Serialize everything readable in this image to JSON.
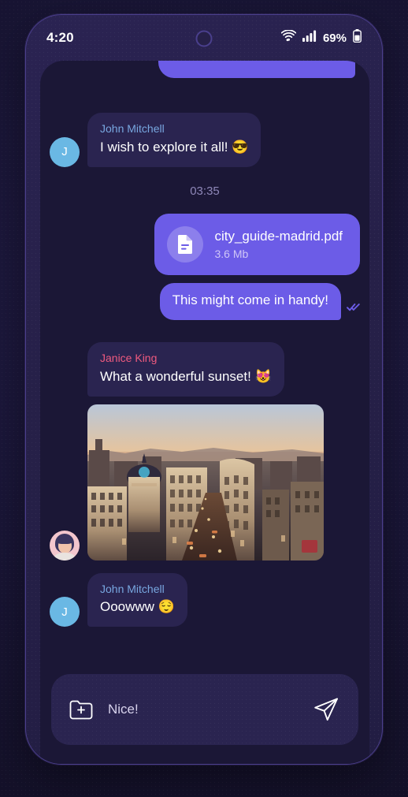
{
  "status_bar": {
    "time": "4:20",
    "battery_percent": "69%",
    "icons": [
      "wifi-icon",
      "cellular-signal-icon",
      "battery-icon",
      "camera-punch-hole"
    ]
  },
  "chat": {
    "timestamp_divider": "03:35",
    "messages": [
      {
        "id": "clipped",
        "direction": "outgoing",
        "text": ""
      },
      {
        "id": "m1",
        "direction": "incoming",
        "sender": "John Mitchell",
        "sender_color": "#78a7e0",
        "text": "I wish to explore it all! 😎",
        "avatar_letter": "J"
      },
      {
        "id": "m2",
        "direction": "outgoing",
        "type": "file",
        "file_name": "city_guide-madrid.pdf",
        "file_size": "3.6 Mb",
        "file_icon": "document-icon"
      },
      {
        "id": "m3",
        "direction": "outgoing",
        "text": "This might come in handy!",
        "receipt": "read-double-check"
      },
      {
        "id": "m4",
        "direction": "incoming",
        "sender": "Janice King",
        "sender_color": "#ef5a7f",
        "text": "What a wonderful sunset! 😻"
      },
      {
        "id": "m5",
        "direction": "incoming",
        "type": "photo",
        "photo_alt": "Madrid Gran Via cityscape at sunset",
        "avatar_type": "photo"
      },
      {
        "id": "m6",
        "direction": "incoming",
        "sender": "John Mitchell",
        "sender_color": "#78a7e0",
        "text": "Ooowww 😌",
        "avatar_letter": "J"
      }
    ]
  },
  "composer": {
    "value": "Nice!",
    "placeholder": "Message",
    "attach_icon": "folder-plus-icon",
    "send_icon": "send-paper-plane-icon"
  },
  "colors": {
    "accent_purple": "#6c5ce7",
    "incoming_bubble": "#2a2450",
    "screen_bg": "#1b1736",
    "phone_body": "#262048",
    "backdrop": "#171434",
    "sender_blue": "#78a7e0",
    "sender_pink": "#ef5a7f",
    "avatar_blue": "#6ab8e4"
  }
}
